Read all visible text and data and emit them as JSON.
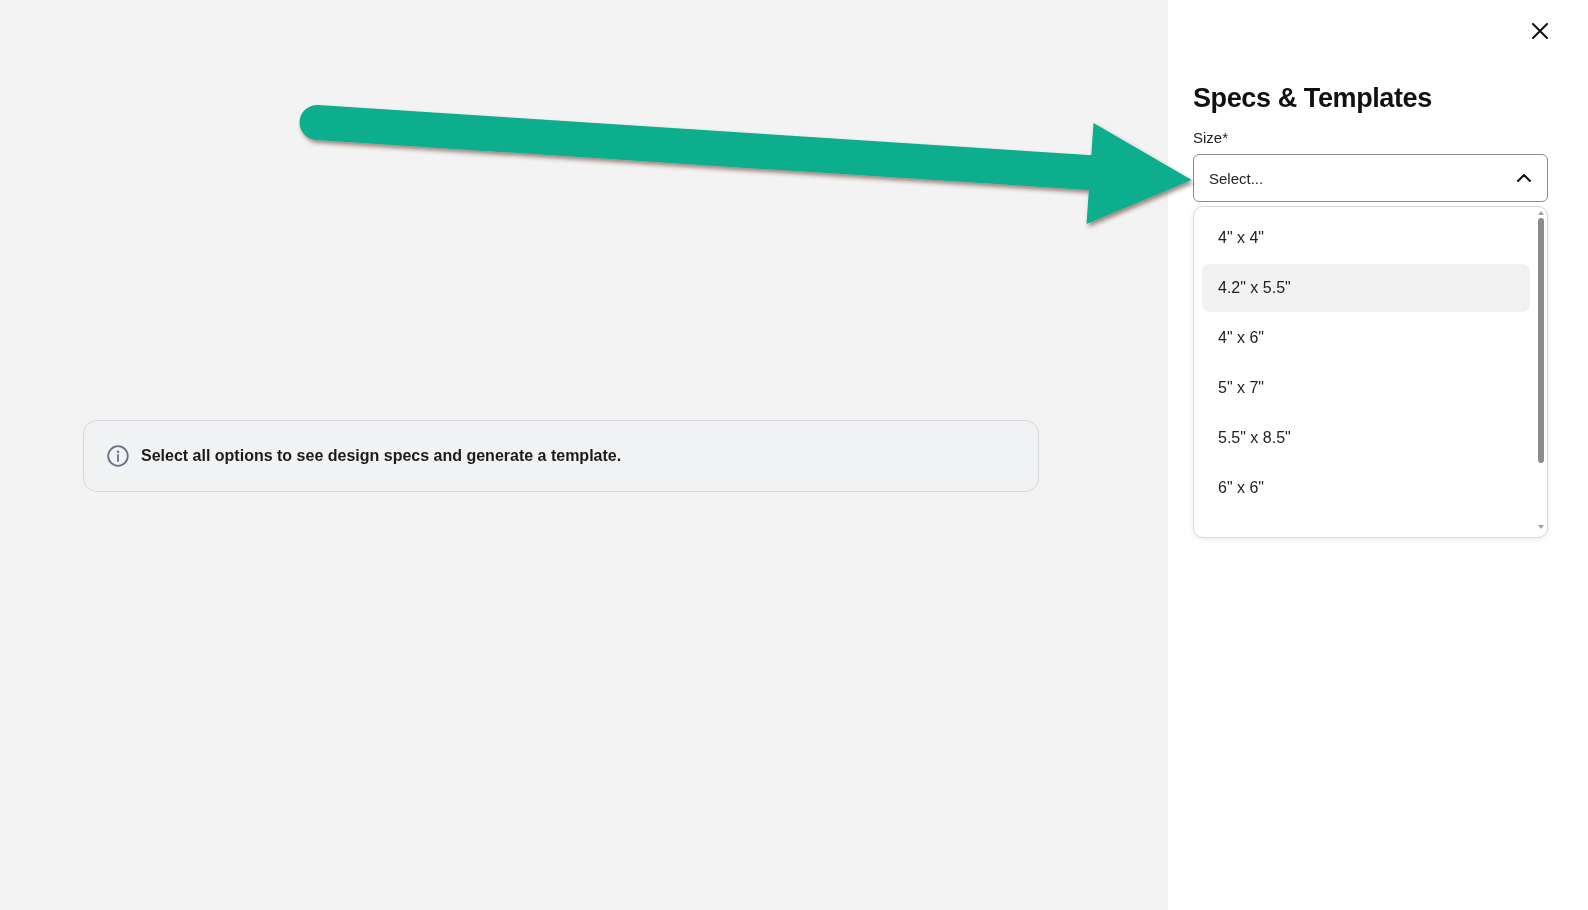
{
  "notice": {
    "text": "Select all options to see design specs and generate a template."
  },
  "panel": {
    "title": "Specs & Templates",
    "size_field": {
      "label": "Size*",
      "placeholder": "Select...",
      "expanded": true,
      "options": [
        {
          "label": "4\" x 4\"",
          "selected": false
        },
        {
          "label": "4.2\" x 5.5\"",
          "selected": true
        },
        {
          "label": "4\" x 6\"",
          "selected": false
        },
        {
          "label": "5\" x 7\"",
          "selected": false
        },
        {
          "label": "5.5\" x 8.5\"",
          "selected": false
        },
        {
          "label": "6\" x 6\"",
          "selected": false
        }
      ]
    }
  }
}
